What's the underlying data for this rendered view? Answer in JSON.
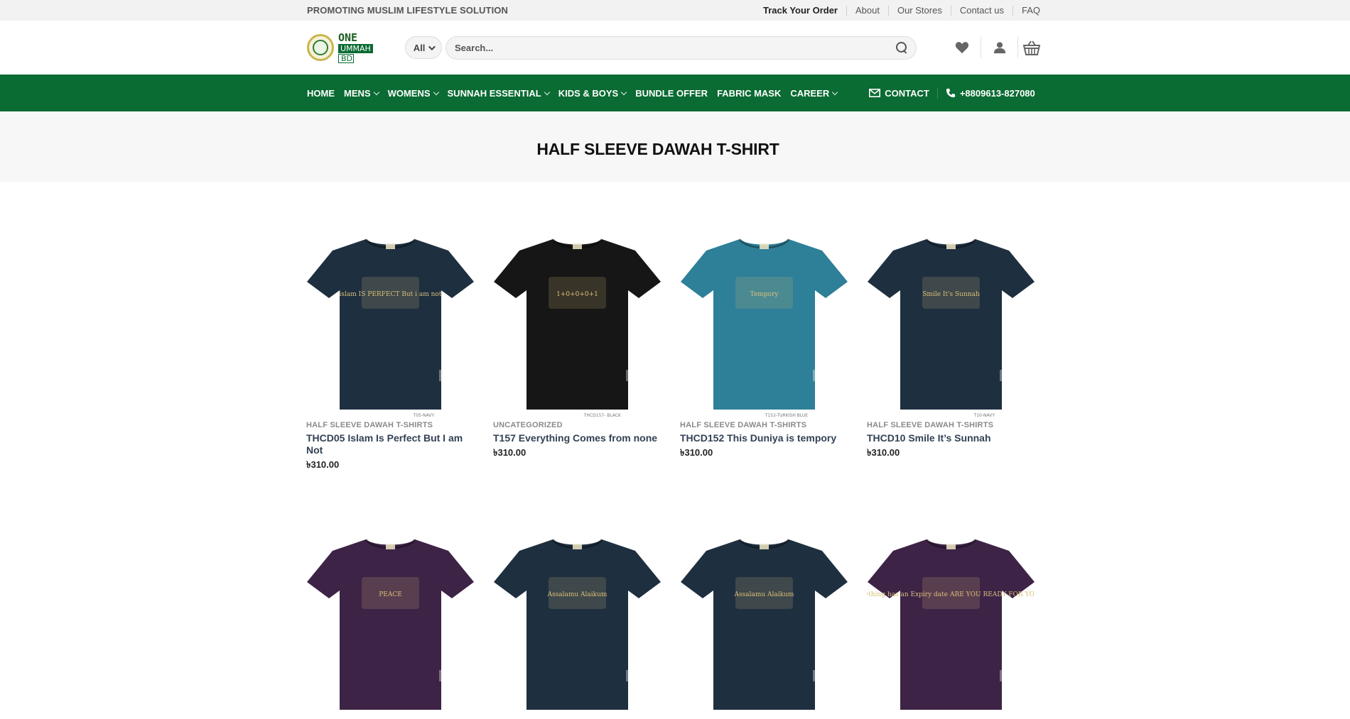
{
  "topbar": {
    "tagline": "PROMOTING MUSLIM LIFESTYLE SOLUTION",
    "links": [
      "Track Your Order",
      "About",
      "Our Stores",
      "Contact us",
      "FAQ"
    ]
  },
  "header": {
    "logo": {
      "line1": "ONE",
      "line2": "UMMAH",
      "line3": "BD"
    },
    "category_select": "All",
    "search_placeholder": "Search..."
  },
  "nav": {
    "items": [
      {
        "label": "HOME",
        "dropdown": false
      },
      {
        "label": "MENS",
        "dropdown": true
      },
      {
        "label": "WOMENS",
        "dropdown": true
      },
      {
        "label": "SUNNAH ESSENTIAL",
        "dropdown": true
      },
      {
        "label": "KIDS & BOYS",
        "dropdown": true
      },
      {
        "label": "BUNDLE OFFER",
        "dropdown": false
      },
      {
        "label": "FABRIC MASK",
        "dropdown": false
      },
      {
        "label": "CAREER",
        "dropdown": true
      }
    ],
    "contact": "CONTACT",
    "phone": "+8809613-827080"
  },
  "page_title": "HALF SLEEVE DAWAH T-SHIRT",
  "products": [
    {
      "category": "HALF SLEEVE DAWAH T-SHIRTS",
      "name": "THCD05 Islam Is Perfect But I am Not",
      "price": "৳310.00",
      "shirt_color": "#1e2f40",
      "print": "islam IS PERFECT But i am not",
      "tag": "T05-NAVY"
    },
    {
      "category": "UNCATEGORIZED",
      "name": "T157 Everything Comes from none",
      "price": "৳310.00",
      "shirt_color": "#161616",
      "print": "1+0+0+0+1",
      "tag": "THCD157- BLACK"
    },
    {
      "category": "HALF SLEEVE DAWAH T-SHIRTS",
      "name": "THCD152 This Duniya is tempory",
      "price": "৳310.00",
      "shirt_color": "#2e7f98",
      "print": "Tempory",
      "tag": "T152-TURKISH BLUE"
    },
    {
      "category": "HALF SLEEVE DAWAH T-SHIRTS",
      "name": "THCD10 Smile It’s Sunnah",
      "price": "৳310.00",
      "shirt_color": "#1e2f40",
      "print": "Smile It's Sunnah",
      "tag": "T10-NAVY"
    },
    {
      "shirt_color": "#3d2346",
      "print": "PEACE"
    },
    {
      "shirt_color": "#1e2f40",
      "print": "Assalamu Alaikum"
    },
    {
      "shirt_color": "#1e2f40",
      "print": "Assalamu Alaikum"
    },
    {
      "shirt_color": "#3d2346",
      "print": "Everything has an Expiry date ARE YOU READY FOR YOURS?"
    }
  ]
}
